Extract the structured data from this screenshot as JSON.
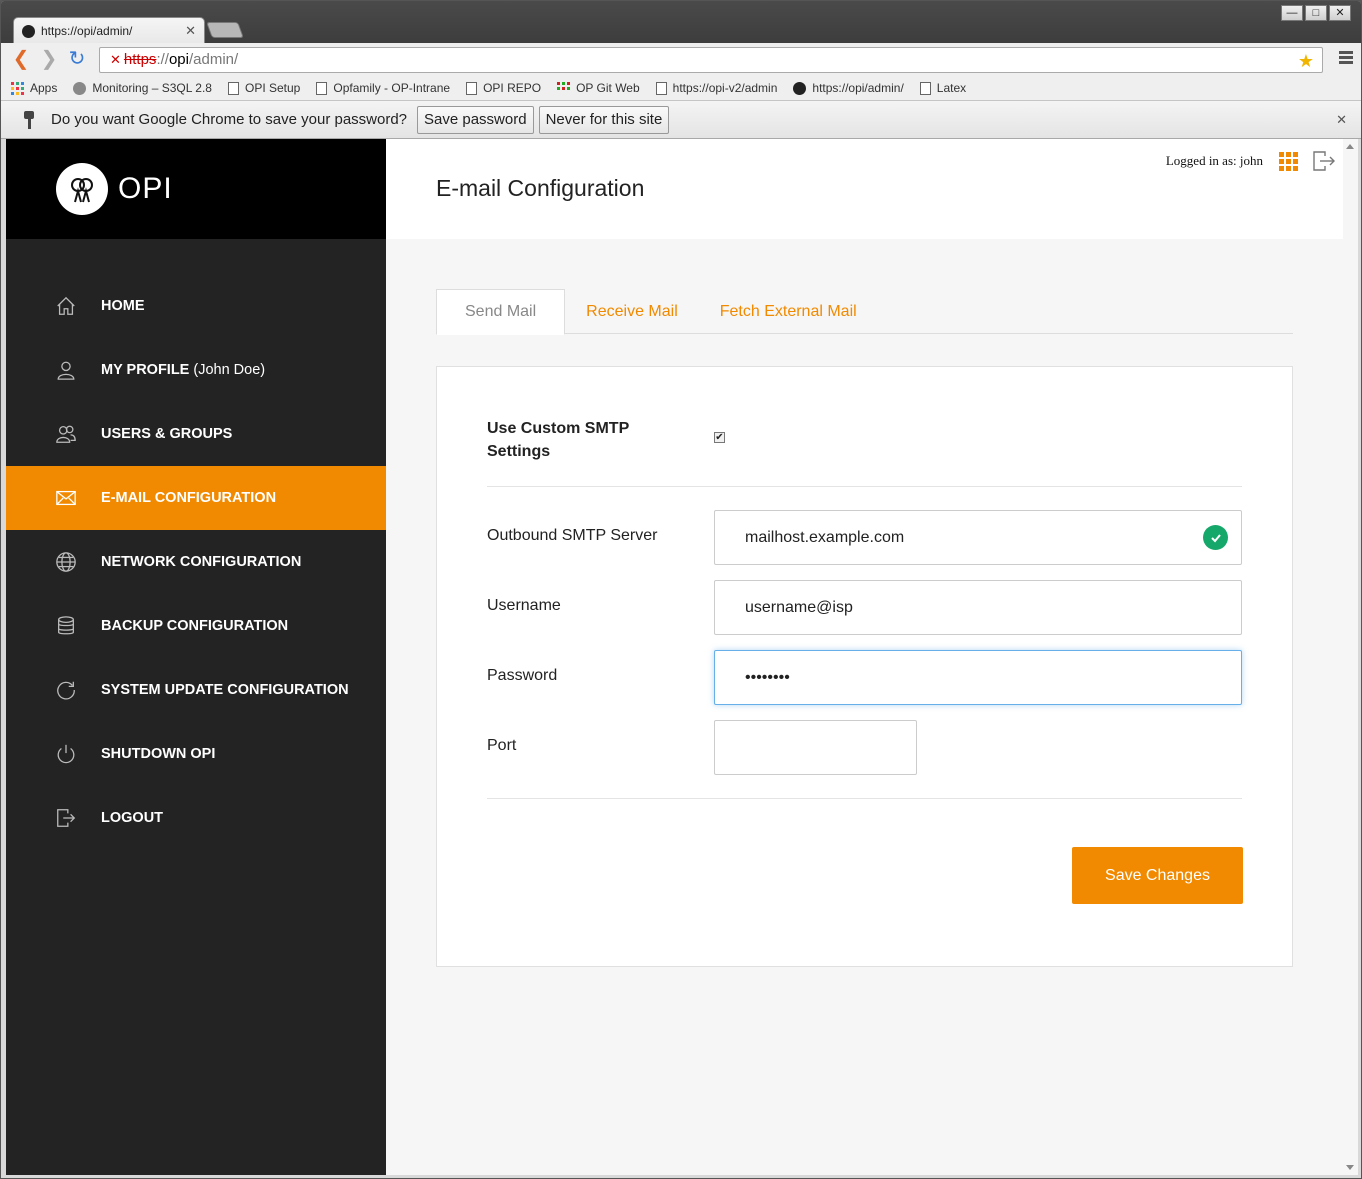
{
  "browser": {
    "tab_title": "https://opi/admin/",
    "url_scheme": "https",
    "url_sep": "://",
    "url_host": "opi",
    "url_path": "/admin/",
    "window_controls": [
      "—",
      "□",
      "✕"
    ],
    "bookmarks": [
      {
        "label": "Apps",
        "icon": "apps-icon"
      },
      {
        "label": "Monitoring – S3QL 2.8",
        "icon": "monitoring-icon"
      },
      {
        "label": "OPI Setup",
        "icon": "page-icon"
      },
      {
        "label": "Opfamily - OP-Intrane",
        "icon": "page-icon"
      },
      {
        "label": "OPI REPO",
        "icon": "page-icon"
      },
      {
        "label": "OP Git Web",
        "icon": "git-icon"
      },
      {
        "label": "https://opi-v2/admin",
        "icon": "page-icon"
      },
      {
        "label": "https://opi/admin/",
        "icon": "opi-icon"
      },
      {
        "label": "Latex",
        "icon": "page-icon"
      }
    ],
    "infobar": {
      "message": "Do you want Google Chrome to save your password?",
      "save_label": "Save password",
      "never_label": "Never for this site"
    }
  },
  "app": {
    "brand": "OPI",
    "header": {
      "title": "E-mail Configuration",
      "logged_in": "Logged in as: john"
    },
    "nav": [
      {
        "label": "HOME",
        "sub": "",
        "icon": "home-icon",
        "active": false
      },
      {
        "label": "MY PROFILE",
        "sub": "(John Doe)",
        "icon": "user-icon",
        "active": false
      },
      {
        "label": "USERS & GROUPS",
        "sub": "",
        "icon": "users-icon",
        "active": false
      },
      {
        "label": "E-MAIL CONFIGURATION",
        "sub": "",
        "icon": "mail-icon",
        "active": true
      },
      {
        "label": "NETWORK CONFIGURATION",
        "sub": "",
        "icon": "globe-icon",
        "active": false
      },
      {
        "label": "BACKUP CONFIGURATION",
        "sub": "",
        "icon": "database-icon",
        "active": false
      },
      {
        "label": "SYSTEM UPDATE CONFIGURATION",
        "sub": "",
        "icon": "refresh-icon",
        "active": false
      },
      {
        "label": "SHUTDOWN OPI",
        "sub": "",
        "icon": "power-icon",
        "active": false
      },
      {
        "label": "LOGOUT",
        "sub": "",
        "icon": "logout-icon",
        "active": false
      }
    ],
    "tabs": [
      {
        "label": "Send Mail",
        "active": true
      },
      {
        "label": "Receive Mail",
        "active": false
      },
      {
        "label": "Fetch External Mail",
        "active": false
      }
    ],
    "form": {
      "custom_smtp_label": "Use Custom SMTP Settings",
      "custom_smtp_checked": true,
      "server_label": "Outbound SMTP Server",
      "server_value": "mailhost.example.com",
      "username_label": "Username",
      "username_value": "username@isp",
      "password_label": "Password",
      "password_value": "••••••••",
      "port_label": "Port",
      "port_value": "",
      "save_label": "Save Changes"
    },
    "colors": {
      "accent": "#f18a00",
      "sidebar": "#232323",
      "success": "#16a86a"
    }
  }
}
